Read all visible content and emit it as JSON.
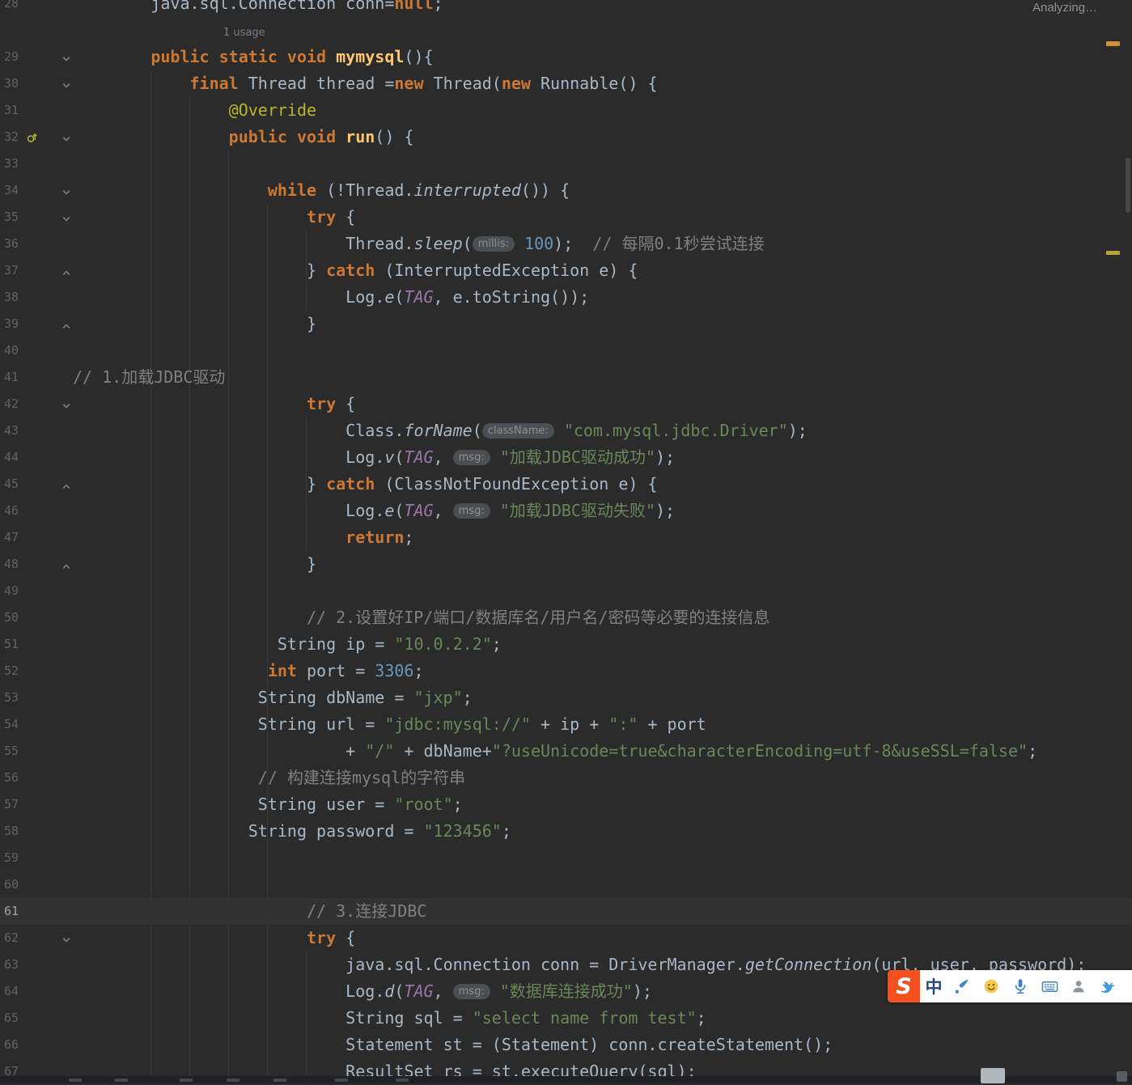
{
  "theme": {
    "palette": {
      "background": "#2B2B2B",
      "current_line": "#323232",
      "default_text": "#A9B7C6",
      "keyword": "#CC7832",
      "method": "#FFC66D",
      "string": "#6A8759",
      "number": "#6897BB",
      "comment": "#808080",
      "field": "#9876AA",
      "annotation": "#BBB529",
      "line_number": "#606366",
      "inlay_bg": "#4B4E52",
      "inlay_text": "#8E9193",
      "guide": "#393939"
    },
    "warning_mark_colors": [
      "#C9913A",
      "#B5A33B"
    ]
  },
  "editor": {
    "analyzing_label": "Analyzing…",
    "rows": [
      {
        "ln": "28",
        "segs": [
          [
            "sp",
            8
          ],
          [
            "txt",
            "java.sql.Connection conn="
          ],
          [
            "kw",
            "null"
          ],
          [
            "txt",
            ";"
          ]
        ]
      },
      {
        "hint": "1 usage"
      },
      {
        "ln": "29",
        "fold": "down",
        "segs": [
          [
            "sp",
            8
          ],
          [
            "kw",
            "public static void "
          ],
          [
            "fn",
            "mymysql"
          ],
          [
            "txt",
            "(){"
          ]
        ]
      },
      {
        "ln": "30",
        "fold": "down",
        "segs": [
          [
            "sp",
            12
          ],
          [
            "kw",
            "final"
          ],
          [
            "txt",
            " Thread thread ="
          ],
          [
            "kw",
            "new"
          ],
          [
            "txt",
            " Thread("
          ],
          [
            "kw",
            "new"
          ],
          [
            "txt",
            " Runnable() {"
          ]
        ]
      },
      {
        "ln": "31",
        "segs": [
          [
            "sp",
            16
          ],
          [
            "ann",
            "@Override"
          ]
        ]
      },
      {
        "ln": "32",
        "fold": "down",
        "override": true,
        "segs": [
          [
            "sp",
            16
          ],
          [
            "kw",
            "public void "
          ],
          [
            "fn",
            "run"
          ],
          [
            "txt",
            "() {"
          ]
        ]
      },
      {
        "ln": "33",
        "segs": []
      },
      {
        "ln": "34",
        "fold": "down",
        "segs": [
          [
            "sp",
            20
          ],
          [
            "kw",
            "while"
          ],
          [
            "txt",
            " (!Thread."
          ],
          [
            "itm",
            "interrupted"
          ],
          [
            "txt",
            "()) {"
          ]
        ]
      },
      {
        "ln": "35",
        "fold": "down",
        "segs": [
          [
            "sp",
            24
          ],
          [
            "kw",
            "try"
          ],
          [
            "txt",
            " {"
          ]
        ]
      },
      {
        "ln": "36",
        "segs": [
          [
            "sp",
            28
          ],
          [
            "txt",
            "Thread."
          ],
          [
            "itm",
            "sleep"
          ],
          [
            "txt",
            "("
          ],
          [
            "hint",
            "millis:"
          ],
          [
            "txt",
            " "
          ],
          [
            "num",
            "100"
          ],
          [
            "txt",
            ");  "
          ],
          [
            "cmt",
            "// 每隔0.1秒尝试连接"
          ]
        ]
      },
      {
        "ln": "37",
        "fold": "up",
        "segs": [
          [
            "sp",
            24
          ],
          [
            "txt",
            "} "
          ],
          [
            "kw",
            "catch"
          ],
          [
            "txt",
            " (InterruptedException e) {"
          ]
        ]
      },
      {
        "ln": "38",
        "segs": [
          [
            "sp",
            28
          ],
          [
            "txt",
            "Log."
          ],
          [
            "itm",
            "e"
          ],
          [
            "txt",
            "("
          ],
          [
            "fld",
            "TAG"
          ],
          [
            "txt",
            ", e.toString());"
          ]
        ]
      },
      {
        "ln": "39",
        "fold": "up",
        "segs": [
          [
            "sp",
            24
          ],
          [
            "txt",
            "}"
          ]
        ]
      },
      {
        "ln": "40",
        "segs": []
      },
      {
        "ln": "41",
        "segs": [
          [
            "cmt",
            "// 1.加载JDBC驱动"
          ]
        ]
      },
      {
        "ln": "42",
        "fold": "down",
        "segs": [
          [
            "sp",
            24
          ],
          [
            "kw",
            "try"
          ],
          [
            "txt",
            " {"
          ]
        ]
      },
      {
        "ln": "43",
        "segs": [
          [
            "sp",
            28
          ],
          [
            "txt",
            "Class."
          ],
          [
            "itm",
            "forName"
          ],
          [
            "txt",
            "("
          ],
          [
            "hint",
            "className:"
          ],
          [
            "txt",
            " "
          ],
          [
            "str",
            "\"com.mysql.jdbc.Driver\""
          ],
          [
            "txt",
            ");"
          ]
        ]
      },
      {
        "ln": "44",
        "segs": [
          [
            "sp",
            28
          ],
          [
            "txt",
            "Log."
          ],
          [
            "itm",
            "v"
          ],
          [
            "txt",
            "("
          ],
          [
            "fld",
            "TAG"
          ],
          [
            "txt",
            ", "
          ],
          [
            "hint",
            "msg:"
          ],
          [
            "txt",
            " "
          ],
          [
            "str",
            "\"加载JDBC驱动成功\""
          ],
          [
            "txt",
            ");"
          ]
        ]
      },
      {
        "ln": "45",
        "fold": "up",
        "segs": [
          [
            "sp",
            24
          ],
          [
            "txt",
            "} "
          ],
          [
            "kw",
            "catch"
          ],
          [
            "txt",
            " (ClassNotFoundException e) {"
          ]
        ]
      },
      {
        "ln": "46",
        "segs": [
          [
            "sp",
            28
          ],
          [
            "txt",
            "Log."
          ],
          [
            "itm",
            "e"
          ],
          [
            "txt",
            "("
          ],
          [
            "fld",
            "TAG"
          ],
          [
            "txt",
            ", "
          ],
          [
            "hint",
            "msg:"
          ],
          [
            "txt",
            " "
          ],
          [
            "str",
            "\"加载JDBC驱动失败\""
          ],
          [
            "txt",
            ");"
          ]
        ]
      },
      {
        "ln": "47",
        "segs": [
          [
            "sp",
            28
          ],
          [
            "kw",
            "return"
          ],
          [
            "txt",
            ";"
          ]
        ]
      },
      {
        "ln": "48",
        "fold": "up",
        "segs": [
          [
            "sp",
            24
          ],
          [
            "txt",
            "}"
          ]
        ]
      },
      {
        "ln": "49",
        "segs": []
      },
      {
        "ln": "50",
        "segs": [
          [
            "sp",
            24
          ],
          [
            "cmt",
            "// 2.设置好IP/端口/数据库名/用户名/密码等必要的连接信息"
          ]
        ]
      },
      {
        "ln": "51",
        "segs": [
          [
            "sp",
            21
          ],
          [
            "txt",
            "String ip = "
          ],
          [
            "str",
            "\"10.0.2.2\""
          ],
          [
            "txt",
            ";"
          ]
        ]
      },
      {
        "ln": "52",
        "segs": [
          [
            "sp",
            20
          ],
          [
            "kw",
            "int"
          ],
          [
            "txt",
            " port = "
          ],
          [
            "num",
            "3306"
          ],
          [
            "txt",
            ";"
          ]
        ]
      },
      {
        "ln": "53",
        "segs": [
          [
            "sp",
            19
          ],
          [
            "txt",
            "String dbName = "
          ],
          [
            "str",
            "\"jxp\""
          ],
          [
            "txt",
            ";"
          ]
        ]
      },
      {
        "ln": "54",
        "segs": [
          [
            "sp",
            19
          ],
          [
            "txt",
            "String url = "
          ],
          [
            "str",
            "\"jdbc:mysql://\""
          ],
          [
            "txt",
            " + ip + "
          ],
          [
            "str",
            "\":\""
          ],
          [
            "txt",
            " + port"
          ]
        ]
      },
      {
        "ln": "55",
        "segs": [
          [
            "sp",
            28
          ],
          [
            "txt",
            "+ "
          ],
          [
            "str",
            "\"/\""
          ],
          [
            "txt",
            " + dbName+"
          ],
          [
            "str",
            "\"?useUnicode=true&characterEncoding=utf-8&useSSL=false\""
          ],
          [
            "txt",
            ";"
          ]
        ]
      },
      {
        "ln": "56",
        "segs": [
          [
            "sp",
            19
          ],
          [
            "cmt",
            "// 构建连接mysql的字符串"
          ]
        ]
      },
      {
        "ln": "57",
        "segs": [
          [
            "sp",
            19
          ],
          [
            "txt",
            "String user = "
          ],
          [
            "str",
            "\"root\""
          ],
          [
            "txt",
            ";"
          ]
        ]
      },
      {
        "ln": "58",
        "segs": [
          [
            "sp",
            18
          ],
          [
            "txt",
            "String password = "
          ],
          [
            "str",
            "\"123456\""
          ],
          [
            "txt",
            ";"
          ]
        ]
      },
      {
        "ln": "59",
        "segs": []
      },
      {
        "ln": "60",
        "segs": []
      },
      {
        "ln": "61",
        "current": true,
        "segs": [
          [
            "sp",
            24
          ],
          [
            "cmt",
            "// 3.连接JDBC"
          ]
        ]
      },
      {
        "ln": "62",
        "fold": "down",
        "segs": [
          [
            "sp",
            24
          ],
          [
            "kw",
            "try"
          ],
          [
            "txt",
            " {"
          ]
        ]
      },
      {
        "ln": "63",
        "segs": [
          [
            "sp",
            28
          ],
          [
            "txt",
            "java.sql.Connection conn = DriverManager."
          ],
          [
            "itm",
            "getConnection"
          ],
          [
            "txt",
            "(url, user, password);"
          ]
        ]
      },
      {
        "ln": "64",
        "segs": [
          [
            "sp",
            28
          ],
          [
            "txt",
            "Log."
          ],
          [
            "itm",
            "d"
          ],
          [
            "txt",
            "("
          ],
          [
            "fld",
            "TAG"
          ],
          [
            "txt",
            ", "
          ],
          [
            "hint",
            "msg:"
          ],
          [
            "txt",
            " "
          ],
          [
            "str",
            "\"数据库连接成功\""
          ],
          [
            "txt",
            ");"
          ]
        ]
      },
      {
        "ln": "65",
        "segs": [
          [
            "sp",
            28
          ],
          [
            "txt",
            "String sql = "
          ],
          [
            "str",
            "\"select name from test\""
          ],
          [
            "txt",
            ";"
          ]
        ]
      },
      {
        "ln": "66",
        "segs": [
          [
            "sp",
            28
          ],
          [
            "txt",
            "Statement st = (Statement) conn.createStatement();"
          ]
        ]
      },
      {
        "ln": "67",
        "segs": [
          [
            "sp",
            28
          ],
          [
            "txt",
            "ResultSet rs = st.executeQuery(sql);"
          ]
        ]
      }
    ]
  },
  "ime_toolbar": {
    "logo_text": "S",
    "mode_label": "中",
    "icons": [
      "handwriting",
      "emoji",
      "voice",
      "keyboard",
      "account",
      "skin"
    ]
  }
}
